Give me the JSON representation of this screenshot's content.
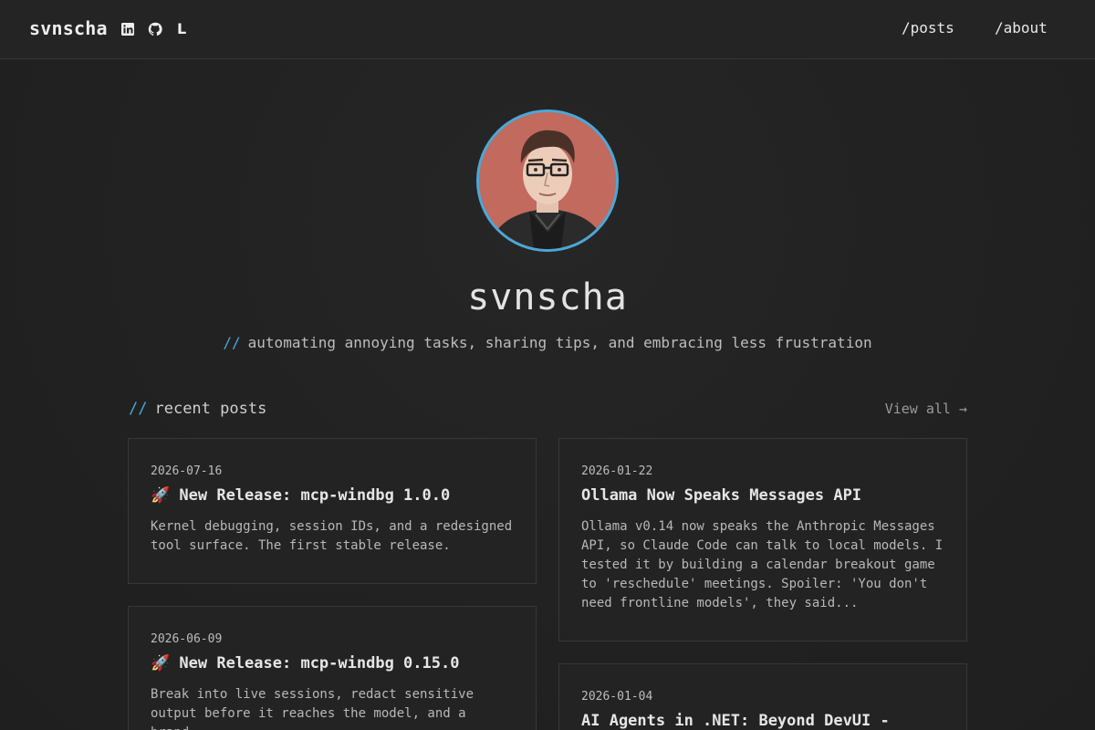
{
  "header": {
    "brand": "svnscha",
    "social_icons": [
      "linkedin-icon",
      "github-icon",
      "lobsters-icon"
    ],
    "lobsters_glyph": "L",
    "nav": [
      {
        "label": "/posts"
      },
      {
        "label": "/about"
      }
    ]
  },
  "hero": {
    "title": "svnscha",
    "tagline_prefix": "//",
    "tagline": "automating annoying tasks, sharing tips, and embracing less frustration"
  },
  "recent": {
    "prefix": "//",
    "heading": "recent posts",
    "view_all": "View all →"
  },
  "posts": [
    {
      "date": "2026-07-16",
      "title": "🚀 New Release: mcp-windbg 1.0.0",
      "description": "Kernel debugging, session IDs, and a redesigned tool surface. The first stable release."
    },
    {
      "date": "2026-01-22",
      "title": "Ollama Now Speaks Messages API",
      "description": "Ollama v0.14 now speaks the Anthropic Messages API, so Claude Code can talk to local models. I tested it by building a calendar breakout game to 'reschedule' meetings. Spoiler: 'You don't need frontline models', they said..."
    },
    {
      "date": "2026-06-09",
      "title": "🚀 New Release: mcp-windbg 0.15.0",
      "description": "Break into live sessions, redact sensitive output before it reaches the model, and a brand-"
    },
    {
      "date": "2026-01-04",
      "title": "AI Agents in .NET: Beyond DevUI -",
      "description": ""
    }
  ],
  "colors": {
    "accent": "#4aa8d8",
    "background": "#212121",
    "card": "#232323"
  }
}
